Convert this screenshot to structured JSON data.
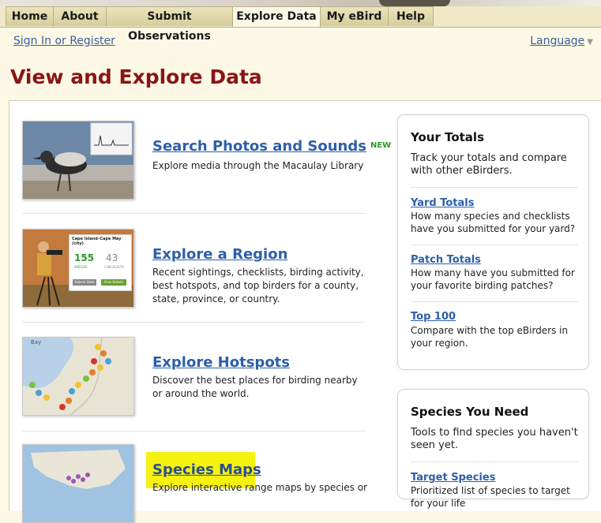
{
  "nav": {
    "tabs": [
      {
        "label": "Home"
      },
      {
        "label": "About"
      },
      {
        "label": "Submit Observations"
      },
      {
        "label": "Explore Data"
      },
      {
        "label": "My eBird"
      },
      {
        "label": "Help"
      }
    ],
    "active_tab": "Explore Data"
  },
  "header": {
    "signin_label": "Sign In or Register",
    "language_label": "Language",
    "page_title": "View and Explore Data"
  },
  "features": [
    {
      "title": "Search Photos and Sounds",
      "badge": "NEW",
      "description": "Explore media through the Macaulay Library"
    },
    {
      "title": "Explore a Region",
      "description": "Recent sightings, checklists, birding activity, best hotspots, and top birders for a county, state, province, or country.",
      "thumb": {
        "title": "Cape Island–Cape May (city)",
        "species_count": "155",
        "species_label": "SPECIES",
        "checklists_count": "43",
        "checklists_label": "CHECKLISTS",
        "button1": "Submit Data",
        "button2": "View Details"
      }
    },
    {
      "title": "Explore Hotspots",
      "description": "Discover the best places for birding nearby or around the world.",
      "thumb": {
        "map_label": "Bay"
      }
    },
    {
      "title": "Species Maps",
      "description": "Explore interactive range maps by species or"
    }
  ],
  "your_totals": {
    "heading": "Your Totals",
    "intro": "Track your totals and compare with other eBirders.",
    "links": [
      {
        "label": "Yard Totals",
        "description": "How many species and checklists have you submitted for your yard?"
      },
      {
        "label": "Patch Totals",
        "description": "How many have you submitted for your favorite birding patches?"
      },
      {
        "label": "Top 100",
        "description": "Compare with the top eBirders in your region."
      }
    ]
  },
  "species_you_need": {
    "heading": "Species You Need",
    "intro": "Tools to find species you haven't seen yet.",
    "links": [
      {
        "label": "Target Species",
        "description": "Prioritized list of species to target for your life"
      }
    ]
  },
  "colors": {
    "title_red": "#8a1515",
    "link_blue": "#2d5fa8",
    "new_green": "#2a9a2a",
    "highlight": "#f5f20f",
    "page_bg": "#fdf8e6"
  }
}
